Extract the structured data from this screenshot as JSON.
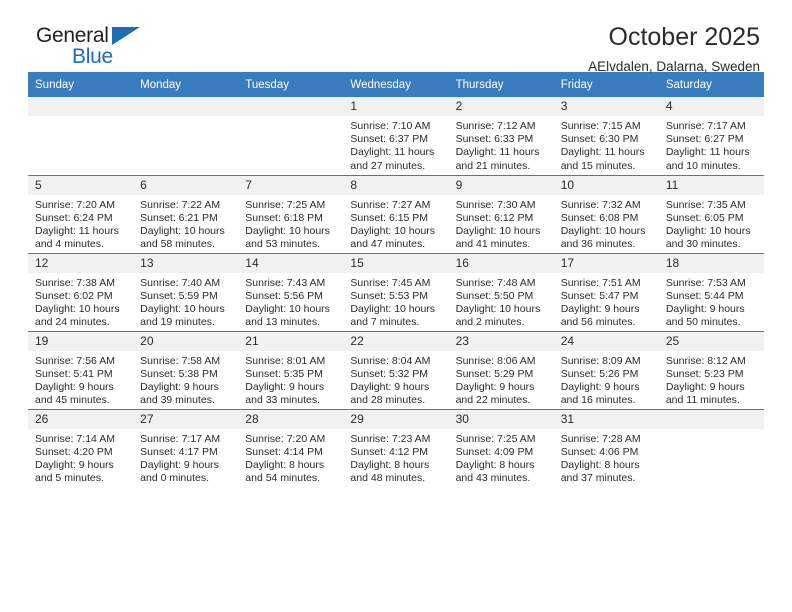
{
  "logo": {
    "word_top": "General",
    "word_bottom": "Blue",
    "accent_color": "#1f6cb4"
  },
  "header": {
    "title": "October 2025",
    "subtitle": "AElvdalen, Dalarna, Sweden"
  },
  "calendar": {
    "header_bg": "#3a7cbe",
    "daynum_bg": "#f1f1f1",
    "weekday_headers": [
      "Sunday",
      "Monday",
      "Tuesday",
      "Wednesday",
      "Thursday",
      "Friday",
      "Saturday"
    ],
    "weeks": [
      [
        {
          "day": "",
          "empty": true
        },
        {
          "day": "",
          "empty": true
        },
        {
          "day": "",
          "empty": true
        },
        {
          "day": "1",
          "sunrise": "Sunrise: 7:10 AM",
          "sunset": "Sunset: 6:37 PM",
          "daylight_1": "Daylight: 11 hours",
          "daylight_2": "and 27 minutes."
        },
        {
          "day": "2",
          "sunrise": "Sunrise: 7:12 AM",
          "sunset": "Sunset: 6:33 PM",
          "daylight_1": "Daylight: 11 hours",
          "daylight_2": "and 21 minutes."
        },
        {
          "day": "3",
          "sunrise": "Sunrise: 7:15 AM",
          "sunset": "Sunset: 6:30 PM",
          "daylight_1": "Daylight: 11 hours",
          "daylight_2": "and 15 minutes."
        },
        {
          "day": "4",
          "sunrise": "Sunrise: 7:17 AM",
          "sunset": "Sunset: 6:27 PM",
          "daylight_1": "Daylight: 11 hours",
          "daylight_2": "and 10 minutes."
        }
      ],
      [
        {
          "day": "5",
          "sunrise": "Sunrise: 7:20 AM",
          "sunset": "Sunset: 6:24 PM",
          "daylight_1": "Daylight: 11 hours",
          "daylight_2": "and 4 minutes."
        },
        {
          "day": "6",
          "sunrise": "Sunrise: 7:22 AM",
          "sunset": "Sunset: 6:21 PM",
          "daylight_1": "Daylight: 10 hours",
          "daylight_2": "and 58 minutes."
        },
        {
          "day": "7",
          "sunrise": "Sunrise: 7:25 AM",
          "sunset": "Sunset: 6:18 PM",
          "daylight_1": "Daylight: 10 hours",
          "daylight_2": "and 53 minutes."
        },
        {
          "day": "8",
          "sunrise": "Sunrise: 7:27 AM",
          "sunset": "Sunset: 6:15 PM",
          "daylight_1": "Daylight: 10 hours",
          "daylight_2": "and 47 minutes."
        },
        {
          "day": "9",
          "sunrise": "Sunrise: 7:30 AM",
          "sunset": "Sunset: 6:12 PM",
          "daylight_1": "Daylight: 10 hours",
          "daylight_2": "and 41 minutes."
        },
        {
          "day": "10",
          "sunrise": "Sunrise: 7:32 AM",
          "sunset": "Sunset: 6:08 PM",
          "daylight_1": "Daylight: 10 hours",
          "daylight_2": "and 36 minutes."
        },
        {
          "day": "11",
          "sunrise": "Sunrise: 7:35 AM",
          "sunset": "Sunset: 6:05 PM",
          "daylight_1": "Daylight: 10 hours",
          "daylight_2": "and 30 minutes."
        }
      ],
      [
        {
          "day": "12",
          "sunrise": "Sunrise: 7:38 AM",
          "sunset": "Sunset: 6:02 PM",
          "daylight_1": "Daylight: 10 hours",
          "daylight_2": "and 24 minutes."
        },
        {
          "day": "13",
          "sunrise": "Sunrise: 7:40 AM",
          "sunset": "Sunset: 5:59 PM",
          "daylight_1": "Daylight: 10 hours",
          "daylight_2": "and 19 minutes."
        },
        {
          "day": "14",
          "sunrise": "Sunrise: 7:43 AM",
          "sunset": "Sunset: 5:56 PM",
          "daylight_1": "Daylight: 10 hours",
          "daylight_2": "and 13 minutes."
        },
        {
          "day": "15",
          "sunrise": "Sunrise: 7:45 AM",
          "sunset": "Sunset: 5:53 PM",
          "daylight_1": "Daylight: 10 hours",
          "daylight_2": "and 7 minutes."
        },
        {
          "day": "16",
          "sunrise": "Sunrise: 7:48 AM",
          "sunset": "Sunset: 5:50 PM",
          "daylight_1": "Daylight: 10 hours",
          "daylight_2": "and 2 minutes."
        },
        {
          "day": "17",
          "sunrise": "Sunrise: 7:51 AM",
          "sunset": "Sunset: 5:47 PM",
          "daylight_1": "Daylight: 9 hours",
          "daylight_2": "and 56 minutes."
        },
        {
          "day": "18",
          "sunrise": "Sunrise: 7:53 AM",
          "sunset": "Sunset: 5:44 PM",
          "daylight_1": "Daylight: 9 hours",
          "daylight_2": "and 50 minutes."
        }
      ],
      [
        {
          "day": "19",
          "sunrise": "Sunrise: 7:56 AM",
          "sunset": "Sunset: 5:41 PM",
          "daylight_1": "Daylight: 9 hours",
          "daylight_2": "and 45 minutes."
        },
        {
          "day": "20",
          "sunrise": "Sunrise: 7:58 AM",
          "sunset": "Sunset: 5:38 PM",
          "daylight_1": "Daylight: 9 hours",
          "daylight_2": "and 39 minutes."
        },
        {
          "day": "21",
          "sunrise": "Sunrise: 8:01 AM",
          "sunset": "Sunset: 5:35 PM",
          "daylight_1": "Daylight: 9 hours",
          "daylight_2": "and 33 minutes."
        },
        {
          "day": "22",
          "sunrise": "Sunrise: 8:04 AM",
          "sunset": "Sunset: 5:32 PM",
          "daylight_1": "Daylight: 9 hours",
          "daylight_2": "and 28 minutes."
        },
        {
          "day": "23",
          "sunrise": "Sunrise: 8:06 AM",
          "sunset": "Sunset: 5:29 PM",
          "daylight_1": "Daylight: 9 hours",
          "daylight_2": "and 22 minutes."
        },
        {
          "day": "24",
          "sunrise": "Sunrise: 8:09 AM",
          "sunset": "Sunset: 5:26 PM",
          "daylight_1": "Daylight: 9 hours",
          "daylight_2": "and 16 minutes."
        },
        {
          "day": "25",
          "sunrise": "Sunrise: 8:12 AM",
          "sunset": "Sunset: 5:23 PM",
          "daylight_1": "Daylight: 9 hours",
          "daylight_2": "and 11 minutes."
        }
      ],
      [
        {
          "day": "26",
          "sunrise": "Sunrise: 7:14 AM",
          "sunset": "Sunset: 4:20 PM",
          "daylight_1": "Daylight: 9 hours",
          "daylight_2": "and 5 minutes."
        },
        {
          "day": "27",
          "sunrise": "Sunrise: 7:17 AM",
          "sunset": "Sunset: 4:17 PM",
          "daylight_1": "Daylight: 9 hours",
          "daylight_2": "and 0 minutes."
        },
        {
          "day": "28",
          "sunrise": "Sunrise: 7:20 AM",
          "sunset": "Sunset: 4:14 PM",
          "daylight_1": "Daylight: 8 hours",
          "daylight_2": "and 54 minutes."
        },
        {
          "day": "29",
          "sunrise": "Sunrise: 7:23 AM",
          "sunset": "Sunset: 4:12 PM",
          "daylight_1": "Daylight: 8 hours",
          "daylight_2": "and 48 minutes."
        },
        {
          "day": "30",
          "sunrise": "Sunrise: 7:25 AM",
          "sunset": "Sunset: 4:09 PM",
          "daylight_1": "Daylight: 8 hours",
          "daylight_2": "and 43 minutes."
        },
        {
          "day": "31",
          "sunrise": "Sunrise: 7:28 AM",
          "sunset": "Sunset: 4:06 PM",
          "daylight_1": "Daylight: 8 hours",
          "daylight_2": "and 37 minutes."
        },
        {
          "day": "",
          "empty": true
        }
      ]
    ]
  }
}
